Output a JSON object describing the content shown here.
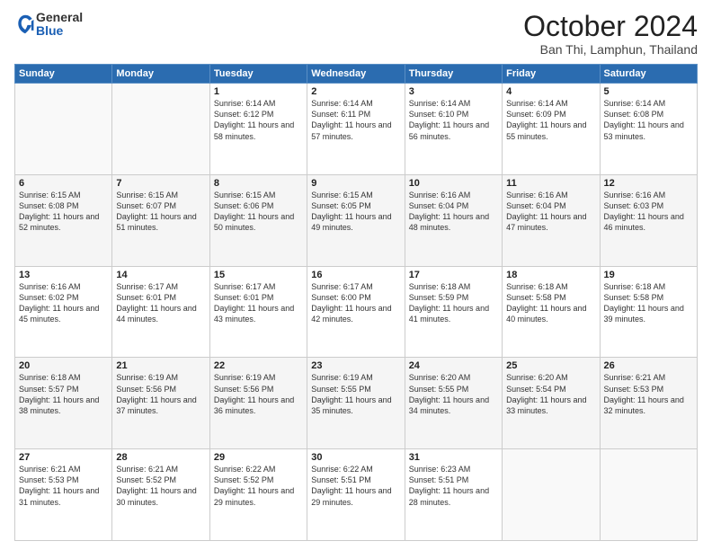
{
  "header": {
    "logo": {
      "general": "General",
      "blue": "Blue"
    },
    "title": "October 2024",
    "location": "Ban Thi, Lamphun, Thailand"
  },
  "weekdays": [
    "Sunday",
    "Monday",
    "Tuesday",
    "Wednesday",
    "Thursday",
    "Friday",
    "Saturday"
  ],
  "weeks": [
    [
      {
        "day": "",
        "empty": true
      },
      {
        "day": "",
        "empty": true
      },
      {
        "day": "1",
        "sunrise": "6:14 AM",
        "sunset": "6:12 PM",
        "daylight": "11 hours and 58 minutes."
      },
      {
        "day": "2",
        "sunrise": "6:14 AM",
        "sunset": "6:11 PM",
        "daylight": "11 hours and 57 minutes."
      },
      {
        "day": "3",
        "sunrise": "6:14 AM",
        "sunset": "6:10 PM",
        "daylight": "11 hours and 56 minutes."
      },
      {
        "day": "4",
        "sunrise": "6:14 AM",
        "sunset": "6:09 PM",
        "daylight": "11 hours and 55 minutes."
      },
      {
        "day": "5",
        "sunrise": "6:14 AM",
        "sunset": "6:08 PM",
        "daylight": "11 hours and 53 minutes."
      }
    ],
    [
      {
        "day": "6",
        "sunrise": "6:15 AM",
        "sunset": "6:08 PM",
        "daylight": "11 hours and 52 minutes."
      },
      {
        "day": "7",
        "sunrise": "6:15 AM",
        "sunset": "6:07 PM",
        "daylight": "11 hours and 51 minutes."
      },
      {
        "day": "8",
        "sunrise": "6:15 AM",
        "sunset": "6:06 PM",
        "daylight": "11 hours and 50 minutes."
      },
      {
        "day": "9",
        "sunrise": "6:15 AM",
        "sunset": "6:05 PM",
        "daylight": "11 hours and 49 minutes."
      },
      {
        "day": "10",
        "sunrise": "6:16 AM",
        "sunset": "6:04 PM",
        "daylight": "11 hours and 48 minutes."
      },
      {
        "day": "11",
        "sunrise": "6:16 AM",
        "sunset": "6:04 PM",
        "daylight": "11 hours and 47 minutes."
      },
      {
        "day": "12",
        "sunrise": "6:16 AM",
        "sunset": "6:03 PM",
        "daylight": "11 hours and 46 minutes."
      }
    ],
    [
      {
        "day": "13",
        "sunrise": "6:16 AM",
        "sunset": "6:02 PM",
        "daylight": "11 hours and 45 minutes."
      },
      {
        "day": "14",
        "sunrise": "6:17 AM",
        "sunset": "6:01 PM",
        "daylight": "11 hours and 44 minutes."
      },
      {
        "day": "15",
        "sunrise": "6:17 AM",
        "sunset": "6:01 PM",
        "daylight": "11 hours and 43 minutes."
      },
      {
        "day": "16",
        "sunrise": "6:17 AM",
        "sunset": "6:00 PM",
        "daylight": "11 hours and 42 minutes."
      },
      {
        "day": "17",
        "sunrise": "6:18 AM",
        "sunset": "5:59 PM",
        "daylight": "11 hours and 41 minutes."
      },
      {
        "day": "18",
        "sunrise": "6:18 AM",
        "sunset": "5:58 PM",
        "daylight": "11 hours and 40 minutes."
      },
      {
        "day": "19",
        "sunrise": "6:18 AM",
        "sunset": "5:58 PM",
        "daylight": "11 hours and 39 minutes."
      }
    ],
    [
      {
        "day": "20",
        "sunrise": "6:18 AM",
        "sunset": "5:57 PM",
        "daylight": "11 hours and 38 minutes."
      },
      {
        "day": "21",
        "sunrise": "6:19 AM",
        "sunset": "5:56 PM",
        "daylight": "11 hours and 37 minutes."
      },
      {
        "day": "22",
        "sunrise": "6:19 AM",
        "sunset": "5:56 PM",
        "daylight": "11 hours and 36 minutes."
      },
      {
        "day": "23",
        "sunrise": "6:19 AM",
        "sunset": "5:55 PM",
        "daylight": "11 hours and 35 minutes."
      },
      {
        "day": "24",
        "sunrise": "6:20 AM",
        "sunset": "5:55 PM",
        "daylight": "11 hours and 34 minutes."
      },
      {
        "day": "25",
        "sunrise": "6:20 AM",
        "sunset": "5:54 PM",
        "daylight": "11 hours and 33 minutes."
      },
      {
        "day": "26",
        "sunrise": "6:21 AM",
        "sunset": "5:53 PM",
        "daylight": "11 hours and 32 minutes."
      }
    ],
    [
      {
        "day": "27",
        "sunrise": "6:21 AM",
        "sunset": "5:53 PM",
        "daylight": "11 hours and 31 minutes."
      },
      {
        "day": "28",
        "sunrise": "6:21 AM",
        "sunset": "5:52 PM",
        "daylight": "11 hours and 30 minutes."
      },
      {
        "day": "29",
        "sunrise": "6:22 AM",
        "sunset": "5:52 PM",
        "daylight": "11 hours and 29 minutes."
      },
      {
        "day": "30",
        "sunrise": "6:22 AM",
        "sunset": "5:51 PM",
        "daylight": "11 hours and 29 minutes."
      },
      {
        "day": "31",
        "sunrise": "6:23 AM",
        "sunset": "5:51 PM",
        "daylight": "11 hours and 28 minutes."
      },
      {
        "day": "",
        "empty": true
      },
      {
        "day": "",
        "empty": true
      }
    ]
  ]
}
